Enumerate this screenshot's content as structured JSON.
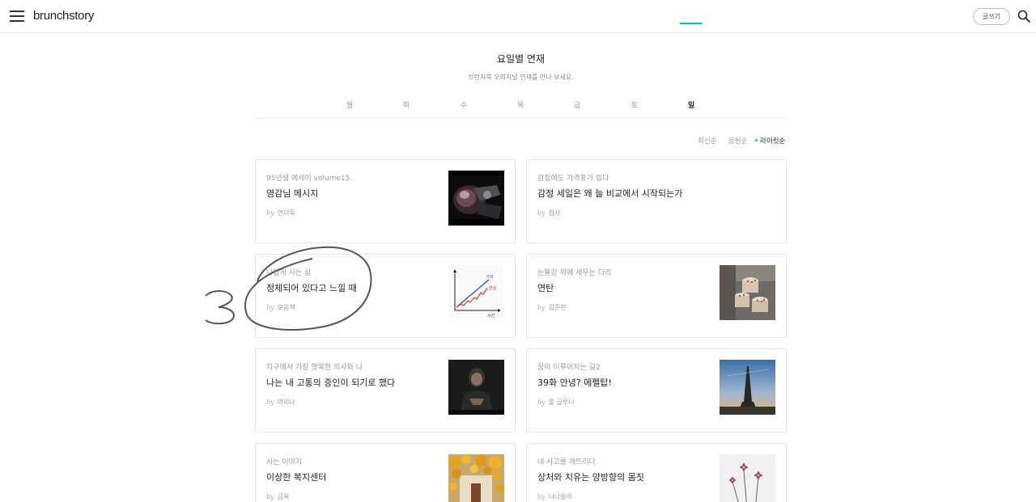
{
  "header": {
    "logo_main": "brunch",
    "logo_sub": "story",
    "write_label": "글쓰기"
  },
  "page": {
    "title": "요일별 연재",
    "subtitle": "브런치북 오리지널 연재를 만나 보세요."
  },
  "tabs": [
    {
      "label": "월",
      "active": false
    },
    {
      "label": "화",
      "active": false
    },
    {
      "label": "수",
      "active": false
    },
    {
      "label": "목",
      "active": false
    },
    {
      "label": "금",
      "active": false
    },
    {
      "label": "토",
      "active": false
    },
    {
      "label": "일",
      "active": true
    }
  ],
  "sort": {
    "latest": "최신순",
    "responses": "응원순",
    "likes": "라이킷순",
    "active": "likes"
  },
  "cards": [
    {
      "series": "95년생 에세이 volume15.",
      "title": "영감님 메시지",
      "by": "by",
      "author": "언더독",
      "thumb": "dark-photo"
    },
    {
      "series": "감정에도 가격표가 있다",
      "title": "감정 세일은 왜 늘 비교에서 시작되는가",
      "by": "by",
      "author": "침사",
      "thumb": ""
    },
    {
      "series": "나답게 사는 삶",
      "title": "정체되어 있다고 느낄 때",
      "by": "by",
      "author": "모음책",
      "thumb": "growth-chart",
      "thumb_labels": {
        "expect": "기대",
        "reality": "현실",
        "time": "시간"
      }
    },
    {
      "series": "눈물강 위에 세우는 다리",
      "title": "연탄",
      "by": "by",
      "author": "김준한",
      "thumb": "briquettes"
    },
    {
      "series": "지구에서 가장 행복한 의사와 나",
      "title": "나는 내 고통의 증인이 되기로 했다",
      "by": "by",
      "author": "미리나",
      "thumb": "person"
    },
    {
      "series": "꿈이 이루어지는 길2",
      "title": "39화 안녕? 에펠탑!",
      "by": "by",
      "author": "줄 글루니",
      "thumb": "eiffel"
    },
    {
      "series": "사는 이야기",
      "title": "이상한 복지센터",
      "by": "by",
      "author": "금옥",
      "thumb": "flowers"
    },
    {
      "series": "내 사고를 깨뜨리다.",
      "title": "상처와 치유는 양방향의 몸짓",
      "by": "by",
      "author": "너나들이",
      "thumb": "cosmos"
    }
  ],
  "annotation": {
    "mark": "3"
  },
  "colors": {
    "accent": "#00c6be",
    "text": "#222222",
    "muted": "#999999",
    "border": "#e5e5e5"
  }
}
